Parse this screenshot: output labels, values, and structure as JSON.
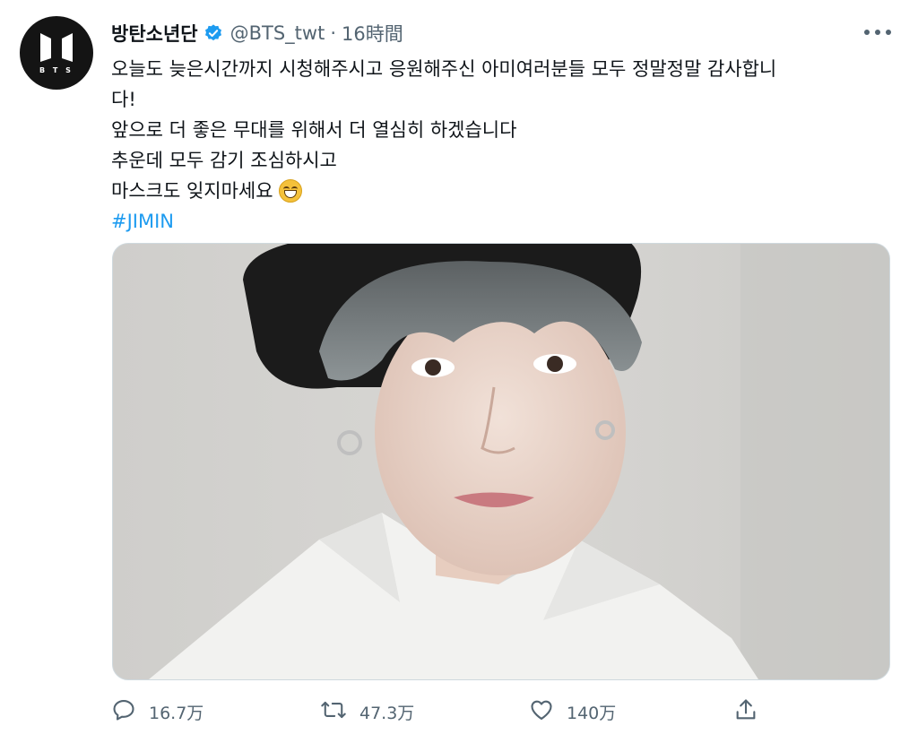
{
  "user": {
    "display_name": "방탄소년단",
    "handle": "@BTS_twt",
    "separator": "·",
    "time": "16時間",
    "avatar_text": "B T S"
  },
  "tweet": {
    "lines": [
      "오늘도 늦은시간까지 시청해주시고 응원해주신 아미여러분들 모두 정말정말 감사합니",
      "다!",
      "앞으로 더 좋은 무대를 위해서 더 열심히 하겠습니다",
      "추운데 모두 감기 조심하시고",
      "마스크도 잊지마세요"
    ],
    "emoji": "grinning-face-with-smiling-eyes",
    "hashtag": "#JIMIN"
  },
  "actions": {
    "reply_count": "16.7万",
    "retweet_count": "47.3万",
    "like_count": "140万"
  },
  "colors": {
    "accent": "#1d9bf0",
    "secondary_text": "#536471",
    "primary_text": "#0f1419"
  },
  "icons": [
    "verified-badge-icon",
    "more-icon",
    "reply-icon",
    "retweet-icon",
    "like-icon",
    "share-icon"
  ]
}
